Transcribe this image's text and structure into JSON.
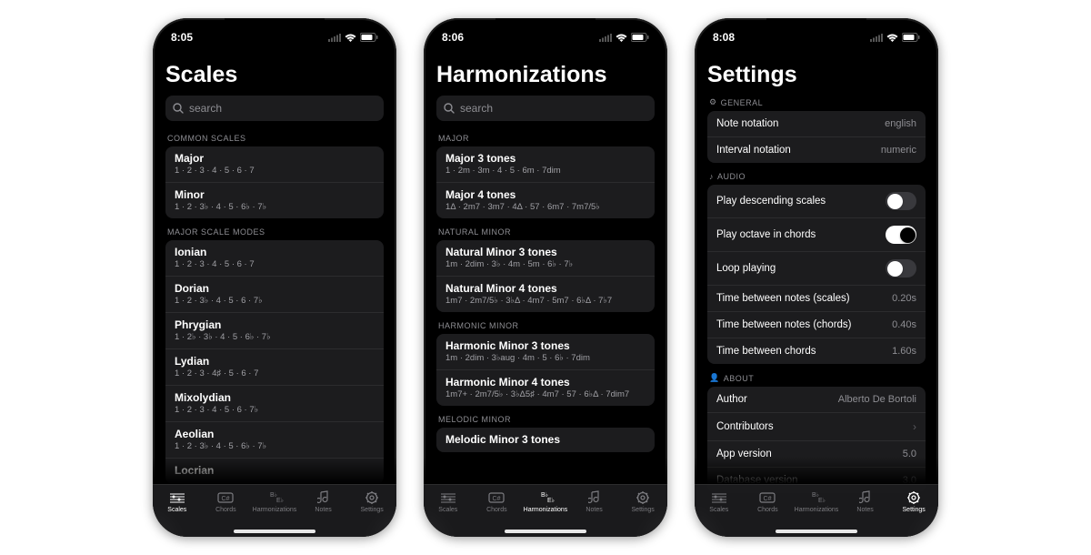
{
  "phones": [
    {
      "time": "8:05",
      "title": "Scales",
      "search_placeholder": "search",
      "active_tab": 0,
      "sections": [
        {
          "header": "COMMON SCALES",
          "rows": [
            {
              "title": "Major",
              "sub": "1 · 2 · 3 · 4 · 5 · 6 · 7"
            },
            {
              "title": "Minor",
              "sub": "1 · 2 · 3♭ · 4 · 5 · 6♭ · 7♭"
            }
          ]
        },
        {
          "header": "MAJOR SCALE MODES",
          "rows": [
            {
              "title": "Ionian",
              "sub": "1 · 2 · 3 · 4 · 5 · 6 · 7"
            },
            {
              "title": "Dorian",
              "sub": "1 · 2 · 3♭ · 4 · 5 · 6 · 7♭"
            },
            {
              "title": "Phrygian",
              "sub": "1 · 2♭ · 3♭ · 4 · 5 · 6♭ · 7♭"
            },
            {
              "title": "Lydian",
              "sub": "1 · 2 · 3 · 4♯ · 5 · 6 · 7"
            },
            {
              "title": "Mixolydian",
              "sub": "1 · 2 · 3 · 4 · 5 · 6 · 7♭"
            },
            {
              "title": "Aeolian",
              "sub": "1 · 2 · 3♭ · 4 · 5 · 6♭ · 7♭"
            },
            {
              "title": "Locrian",
              "sub": ""
            }
          ]
        }
      ]
    },
    {
      "time": "8:06",
      "title": "Harmonizations",
      "search_placeholder": "search",
      "active_tab": 2,
      "sections": [
        {
          "header": "MAJOR",
          "rows": [
            {
              "title": "Major 3 tones",
              "sub": "1 · 2m · 3m · 4 · 5 · 6m · 7dim"
            },
            {
              "title": "Major 4 tones",
              "sub": "1Δ · 2m7 · 3m7 · 4Δ · 57 · 6m7 · 7m7/5♭"
            }
          ]
        },
        {
          "header": "NATURAL MINOR",
          "rows": [
            {
              "title": "Natural Minor 3 tones",
              "sub": "1m · 2dim · 3♭ · 4m · 5m · 6♭ · 7♭"
            },
            {
              "title": "Natural Minor 4 tones",
              "sub": "1m7 · 2m7/5♭ · 3♭Δ · 4m7 · 5m7 · 6♭Δ · 7♭7"
            }
          ]
        },
        {
          "header": "HARMONIC MINOR",
          "rows": [
            {
              "title": "Harmonic Minor 3 tones",
              "sub": "1m · 2dim · 3♭aug · 4m · 5 · 6♭ · 7dim"
            },
            {
              "title": "Harmonic Minor 4 tones",
              "sub": "1m7+ · 2m7/5♭ · 3♭Δ5♯ · 4m7 · 57 · 6♭Δ · 7dim7"
            }
          ]
        },
        {
          "header": "MELODIC MINOR",
          "rows": [
            {
              "title": "Melodic Minor 3 tones",
              "sub": ""
            }
          ]
        }
      ]
    },
    {
      "time": "8:08",
      "title": "Settings",
      "active_tab": 4,
      "setting_sections": [
        {
          "icon": "⚙︎",
          "header": "GENERAL",
          "rows": [
            {
              "label": "Note notation",
              "value": "english",
              "type": "value"
            },
            {
              "label": "Interval notation",
              "value": "numeric",
              "type": "value"
            }
          ]
        },
        {
          "icon": "♪",
          "header": "AUDIO",
          "rows": [
            {
              "label": "Play descending scales",
              "type": "toggle",
              "on": false
            },
            {
              "label": "Play octave in chords",
              "type": "toggle",
              "on": true
            },
            {
              "label": "Loop playing",
              "type": "toggle",
              "on": false
            },
            {
              "label": "Time between notes (scales)",
              "value": "0.20s",
              "type": "value"
            },
            {
              "label": "Time between notes (chords)",
              "value": "0.40s",
              "type": "value"
            },
            {
              "label": "Time between chords",
              "value": "1.60s",
              "type": "value"
            }
          ]
        },
        {
          "icon": "👤",
          "header": "ABOUT",
          "rows": [
            {
              "label": "Author",
              "value": "Alberto De Bortoli",
              "type": "value"
            },
            {
              "label": "Contributors",
              "type": "nav"
            },
            {
              "label": "App version",
              "value": "5.0",
              "type": "value"
            },
            {
              "label": "Database version",
              "value": "3.0",
              "type": "value"
            }
          ]
        }
      ]
    }
  ],
  "tabs": [
    {
      "label": "Scales",
      "icon": "scales"
    },
    {
      "label": "Chords",
      "icon": "chords"
    },
    {
      "label": "Harmonizations",
      "icon": "harmonizations"
    },
    {
      "label": "Notes",
      "icon": "notes"
    },
    {
      "label": "Settings",
      "icon": "settings"
    }
  ]
}
